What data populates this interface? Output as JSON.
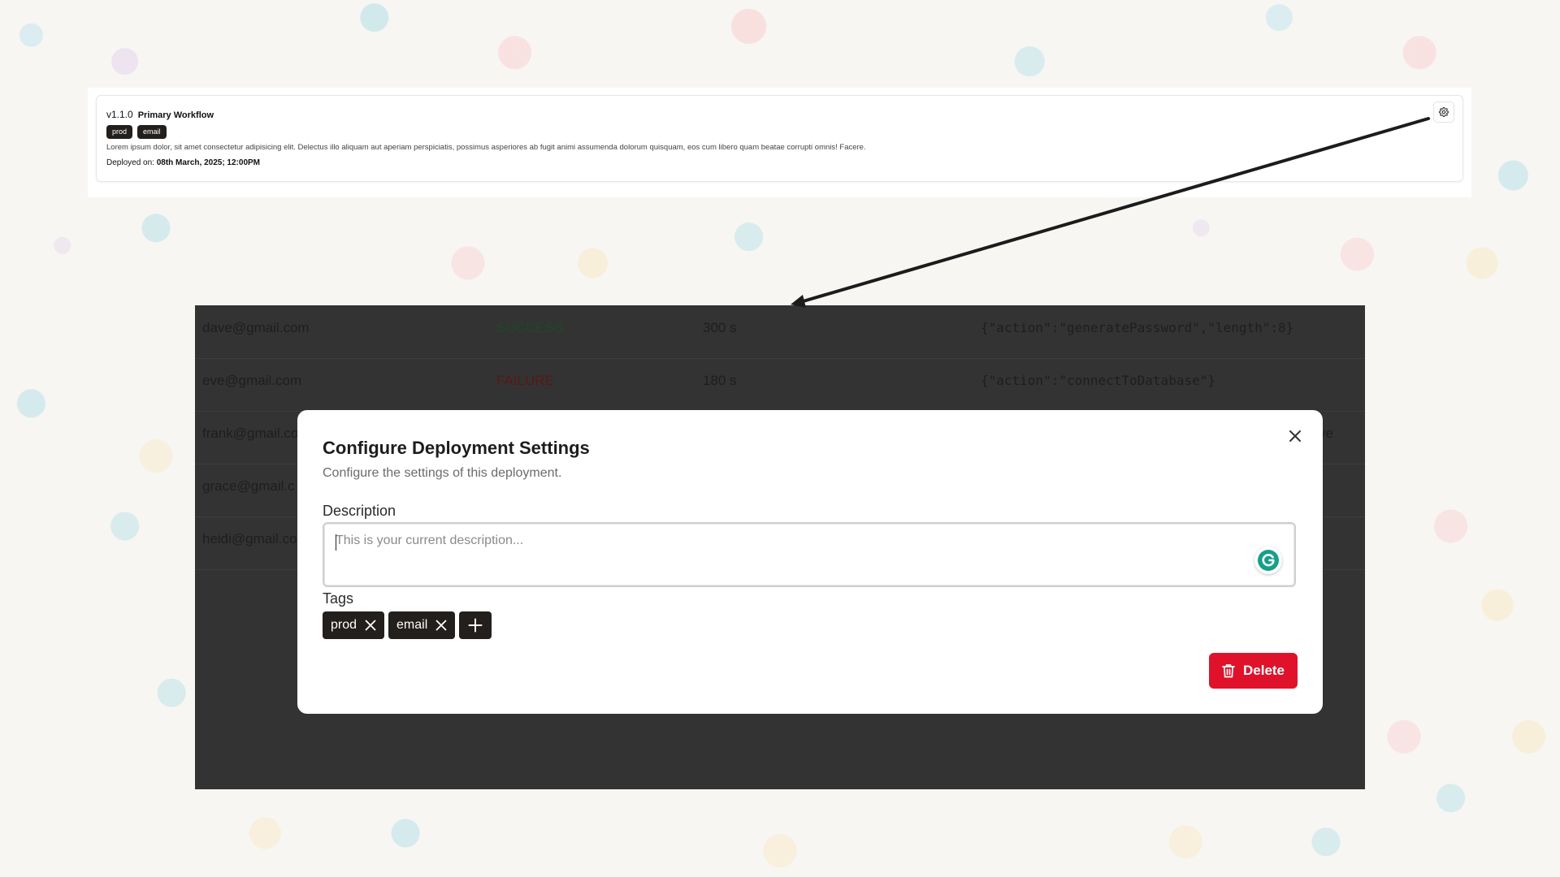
{
  "deployment_card": {
    "version": "v1.1.0",
    "workflow_name": "Primary Workflow",
    "tags": [
      "prod",
      "email"
    ],
    "description": "Lorem ipsum dolor, sit amet consectetur adipisicing elit. Delectus illo aliquam aut aperiam perspiciatis, possimus asperiores ab fugit animi assumenda dolorum quisquam, eos cum libero quam beatae corrupti omnis! Facere.",
    "deployed_label": "Deployed on:",
    "deployed_value": "08th March, 2025; 12:00PM",
    "settings_icon": "gear-icon"
  },
  "log_table": {
    "rows": [
      {
        "email": "dave@gmail.com",
        "status": "SUCCESS",
        "duration": "300 s",
        "payload": "{\"action\":\"generatePassword\",\"length\":8}"
      },
      {
        "email": "eve@gmail.com",
        "status": "FAILURE",
        "duration": "180 s",
        "payload": "{\"action\":\"connectToDatabase\"}"
      },
      {
        "email": "frank@gmail.co",
        "status": "",
        "duration": "",
        "payload": "ve"
      },
      {
        "email": "grace@gmail.c",
        "status": "",
        "duration": "",
        "payload": ""
      },
      {
        "email": "heidi@gmail.co",
        "status": "",
        "duration": "",
        "payload": ""
      }
    ]
  },
  "modal": {
    "title": "Configure Deployment Settings",
    "subtitle": "Configure the settings of this deployment.",
    "description_label": "Description",
    "description_value": "",
    "description_placeholder": "This is your current description...",
    "tags_label": "Tags",
    "tags": [
      "prod",
      "email"
    ],
    "delete_label": "Delete"
  },
  "colors": {
    "dark_chip": "#231f1c",
    "delete_red": "#e0122b",
    "overlay": "#333333",
    "grammarly_green": "#15a08a"
  }
}
